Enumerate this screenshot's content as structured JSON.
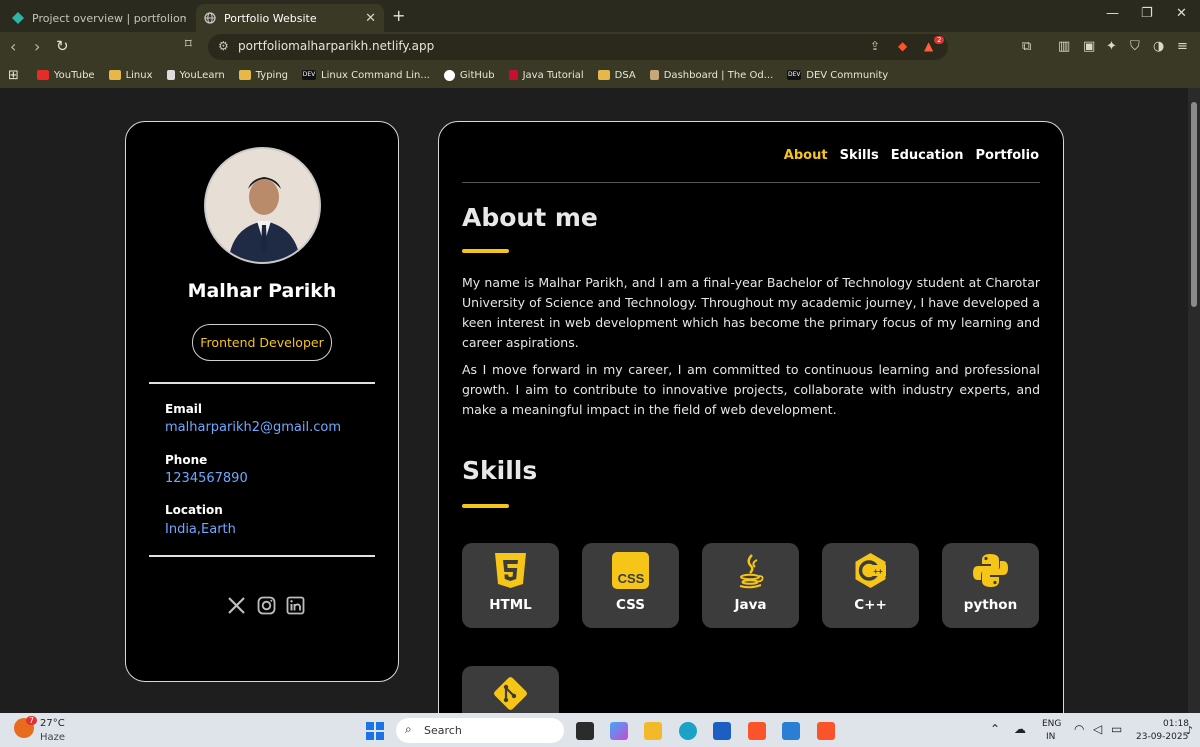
{
  "browser": {
    "tabs": [
      {
        "title": "Project overview | portfoliomalharparikh",
        "active": false
      },
      {
        "title": "Portfolio Website",
        "active": true
      }
    ],
    "url": "portfoliomalharparikh.netlify.app",
    "notification_count": "2",
    "bookmarks": [
      {
        "label": "YouTube",
        "icon": "youtube-icon"
      },
      {
        "label": "Linux",
        "icon": "folder-icon"
      },
      {
        "label": "YouLearn",
        "icon": "youlearn-icon"
      },
      {
        "label": "Typing",
        "icon": "folder-icon"
      },
      {
        "label": "Linux Command Lin...",
        "icon": "dev-icon"
      },
      {
        "label": "GitHub",
        "icon": "github-icon"
      },
      {
        "label": "Java Tutorial",
        "icon": "w3schools-icon"
      },
      {
        "label": "DSA",
        "icon": "folder-icon"
      },
      {
        "label": "Dashboard | The Od...",
        "icon": "odin-icon"
      },
      {
        "label": "DEV Community",
        "icon": "dev-icon"
      }
    ]
  },
  "profile": {
    "name": "Malhar Parikh",
    "role": "Frontend Developer",
    "email_label": "Email",
    "email": "malharparikh2@gmail.com",
    "phone_label": "Phone",
    "phone": "1234567890",
    "location_label": "Location",
    "location": "India,Earth",
    "socials": [
      "x-icon",
      "instagram-icon",
      "linkedin-icon"
    ]
  },
  "nav": {
    "items": [
      "About",
      "Skills",
      "Education",
      "Portfolio"
    ],
    "active": "About"
  },
  "about": {
    "heading": "About me",
    "p1": "My name is Malhar Parikh, and I am a final-year Bachelor of Technology student at Charotar University of Science and Technology. Throughout my academic journey, I have developed a keen interest in web development which has become the primary focus of my learning and career aspirations.",
    "p2": "As I move forward in my career, I am committed to continuous learning and professional growth. I aim to contribute to innovative projects, collaborate with industry experts, and make a meaningful impact in the field of web development."
  },
  "skills": {
    "heading": "Skills",
    "items": [
      {
        "label": "HTML",
        "icon": "html5-icon"
      },
      {
        "label": "CSS",
        "icon": "css3-icon"
      },
      {
        "label": "Java",
        "icon": "java-icon"
      },
      {
        "label": "C++",
        "icon": "cplusplus-icon"
      },
      {
        "label": "python",
        "icon": "python-icon"
      },
      {
        "label": "",
        "icon": "git-icon"
      }
    ]
  },
  "taskbar": {
    "weather_temp": "27°C",
    "weather_desc": "Haze",
    "weather_badge": "7",
    "search_placeholder": "Search",
    "lang": "ENG",
    "region": "IN",
    "time": "01:18",
    "date": "23-09-2025"
  },
  "colors": {
    "accent": "#f5c518",
    "link": "#6ea8ff",
    "card": "#3c3c3c"
  }
}
